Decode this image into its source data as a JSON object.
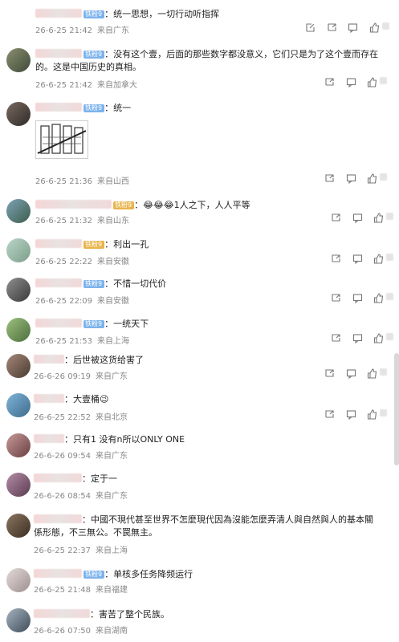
{
  "comments": [
    {
      "text": "统一思想，一切行动听指挥",
      "date": "26-6-25 21:42",
      "source": "来自广东",
      "badge": "铁粉9",
      "badge_color": "blue"
    },
    {
      "text": "没有这个壹，后面的那些数字都没意义，它们只是为了这个壹而存在的。这是中国历史的真相。",
      "date": "26-6-25 21:42",
      "source": "来自加拿大",
      "badge": "铁粉9",
      "badge_color": "blue"
    },
    {
      "text": "统一",
      "date": "26-6-25 21:36",
      "source": "来自山西",
      "badge": "铁粉9",
      "badge_color": "blue"
    },
    {
      "text": "😂😂😂1人之下，人人平等",
      "date": "26-6-25 21:32",
      "source": "来自山东",
      "badge": "铁粉9",
      "badge_color": "gold"
    },
    {
      "text": "利出一孔",
      "date": "26-6-25 22:22",
      "source": "来自安徽",
      "badge": "铁粉9",
      "badge_color": "gold"
    },
    {
      "text": "不惜一切代价",
      "date": "26-6-25 22:09",
      "source": "来自安徽",
      "badge": "铁粉9",
      "badge_color": "blue"
    },
    {
      "text": "一统天下",
      "date": "26-6-25 21:53",
      "source": "来自上海",
      "badge": "铁粉9",
      "badge_color": "blue"
    },
    {
      "text": "后世被这货给害了",
      "date": "26-6-26 09:19",
      "source": "来自广东",
      "badge": "",
      "badge_color": ""
    },
    {
      "text": "大壹桶😉",
      "date": "26-6-25 22:52",
      "source": "来自北京",
      "badge": "",
      "badge_color": ""
    },
    {
      "text": "只有1 没有n所以ONLY ONE",
      "date": "26-6-26 09:54",
      "source": "来自广东",
      "badge": "",
      "badge_color": ""
    },
    {
      "text": "定于一",
      "date": "26-6-26 08:54",
      "source": "来自广东",
      "badge": "",
      "badge_color": ""
    },
    {
      "text": "中國不現代甚至世界不怎麼現代因為沒能怎麼弄清人與自然與人的基本關係形態，不三無公。不罠無主。",
      "date": "26-6-25 22:37",
      "source": "来自上海",
      "badge": "",
      "badge_color": ""
    },
    {
      "text": "单核多任务降频运行",
      "date": "26-6-25 21:48",
      "source": "来自福建",
      "badge": "铁粉9",
      "badge_color": "blue"
    },
    {
      "text": "害苦了整个民族。",
      "date": "26-6-26 07:50",
      "source": "来自湖南",
      "badge": "",
      "badge_color": ""
    }
  ],
  "icons": [
    "share-icon",
    "comment-icon",
    "like-icon"
  ]
}
